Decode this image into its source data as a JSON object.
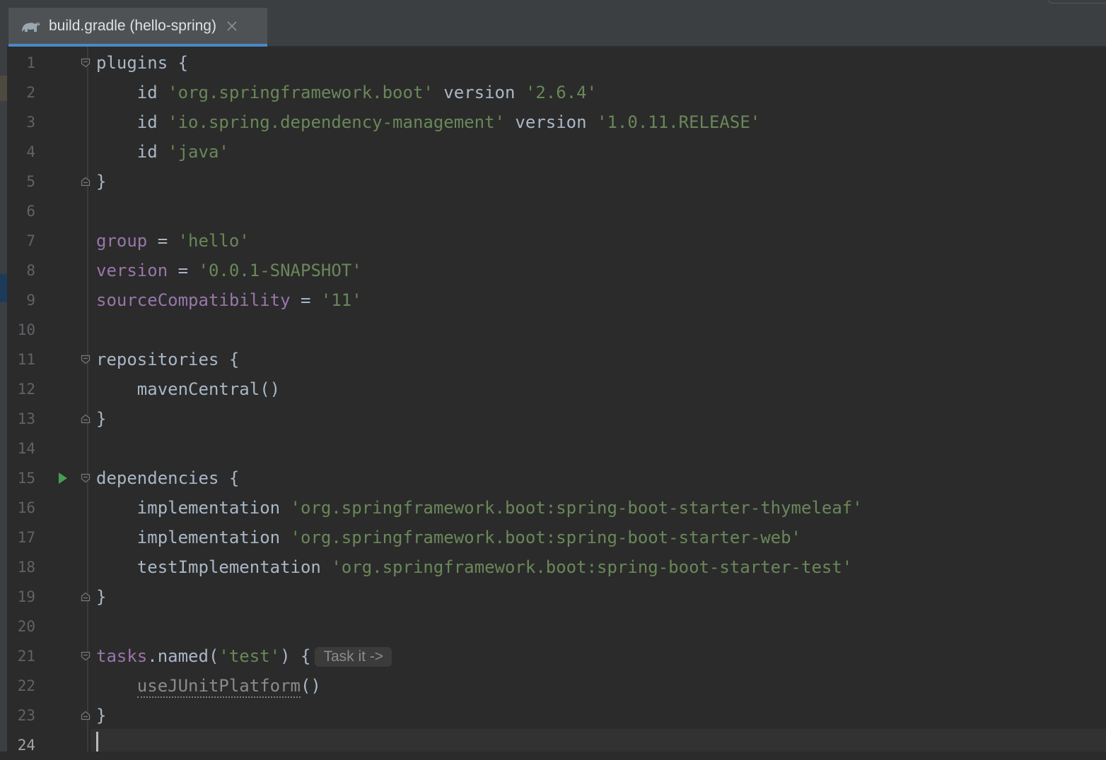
{
  "tab": {
    "icon": "gradle-elephant-icon",
    "label": "build.gradle (hello-spring)",
    "close_icon": "close-icon"
  },
  "editor": {
    "current_line": 24,
    "lines": [
      {
        "n": "1",
        "fold": "open",
        "tokens": [
          {
            "t": "plugins {",
            "c": "plain"
          }
        ]
      },
      {
        "n": "2",
        "tokens": [
          {
            "t": "    id ",
            "c": "plain"
          },
          {
            "t": "'org.springframework.boot'",
            "c": "str"
          },
          {
            "t": " version ",
            "c": "plain"
          },
          {
            "t": "'2.6.4'",
            "c": "str"
          }
        ]
      },
      {
        "n": "3",
        "tokens": [
          {
            "t": "    id ",
            "c": "plain"
          },
          {
            "t": "'io.spring.dependency-management'",
            "c": "str"
          },
          {
            "t": " version ",
            "c": "plain"
          },
          {
            "t": "'1.0.11.RELEASE'",
            "c": "str"
          }
        ]
      },
      {
        "n": "4",
        "tokens": [
          {
            "t": "    id ",
            "c": "plain"
          },
          {
            "t": "'java'",
            "c": "str"
          }
        ]
      },
      {
        "n": "5",
        "fold": "close",
        "tokens": [
          {
            "t": "}",
            "c": "plain"
          }
        ]
      },
      {
        "n": "6",
        "tokens": []
      },
      {
        "n": "7",
        "tokens": [
          {
            "t": "group",
            "c": "prop"
          },
          {
            "t": " = ",
            "c": "plain"
          },
          {
            "t": "'hello'",
            "c": "str"
          }
        ]
      },
      {
        "n": "8",
        "tokens": [
          {
            "t": "version",
            "c": "prop"
          },
          {
            "t": " = ",
            "c": "plain"
          },
          {
            "t": "'0.0.1-SNAPSHOT'",
            "c": "str"
          }
        ]
      },
      {
        "n": "9",
        "tokens": [
          {
            "t": "sourceCompatibility",
            "c": "prop"
          },
          {
            "t": " = ",
            "c": "plain"
          },
          {
            "t": "'11'",
            "c": "str"
          }
        ]
      },
      {
        "n": "10",
        "tokens": []
      },
      {
        "n": "11",
        "fold": "open",
        "tokens": [
          {
            "t": "repositories {",
            "c": "plain"
          }
        ]
      },
      {
        "n": "12",
        "tokens": [
          {
            "t": "    mavenCentral()",
            "c": "plain"
          }
        ]
      },
      {
        "n": "13",
        "fold": "close",
        "tokens": [
          {
            "t": "}",
            "c": "plain"
          }
        ]
      },
      {
        "n": "14",
        "tokens": []
      },
      {
        "n": "15",
        "fold": "open",
        "run": true,
        "tokens": [
          {
            "t": "dependencies {",
            "c": "plain"
          }
        ]
      },
      {
        "n": "16",
        "tokens": [
          {
            "t": "    implementation ",
            "c": "plain"
          },
          {
            "t": "'org.springframework.boot:spring-boot-starter-thymeleaf'",
            "c": "str"
          }
        ]
      },
      {
        "n": "17",
        "tokens": [
          {
            "t": "    implementation ",
            "c": "plain"
          },
          {
            "t": "'org.springframework.boot:spring-boot-starter-web'",
            "c": "str"
          }
        ]
      },
      {
        "n": "18",
        "tokens": [
          {
            "t": "    testImplementation ",
            "c": "plain"
          },
          {
            "t": "'org.springframework.boot:spring-boot-starter-test'",
            "c": "str"
          }
        ]
      },
      {
        "n": "19",
        "fold": "close",
        "tokens": [
          {
            "t": "}",
            "c": "plain"
          }
        ]
      },
      {
        "n": "20",
        "tokens": []
      },
      {
        "n": "21",
        "fold": "open",
        "tokens": [
          {
            "t": "tasks",
            "c": "prop"
          },
          {
            "t": ".named(",
            "c": "plain"
          },
          {
            "t": "'test'",
            "c": "str"
          },
          {
            "t": ") {",
            "c": "plain"
          },
          {
            "t": "Task it ->",
            "c": "inlay"
          }
        ]
      },
      {
        "n": "22",
        "tokens": [
          {
            "t": "    ",
            "c": "plain"
          },
          {
            "t": "useJUnitPlatform",
            "c": "undl"
          },
          {
            "t": "()",
            "c": "plain"
          }
        ]
      },
      {
        "n": "23",
        "fold": "close",
        "tokens": [
          {
            "t": "}",
            "c": "plain"
          }
        ]
      },
      {
        "n": "24",
        "tokens": []
      }
    ]
  },
  "colors": {
    "background": "#2b2b2b",
    "plain": "#a9b7c6",
    "string": "#6a8759",
    "property": "#9876aa",
    "tab_underline": "#4a88c7",
    "run_icon": "#499c54"
  },
  "gutter_icons": {
    "run": "run-gutter-icon",
    "fold_open": "fold-open-icon",
    "fold_close": "fold-close-icon"
  }
}
